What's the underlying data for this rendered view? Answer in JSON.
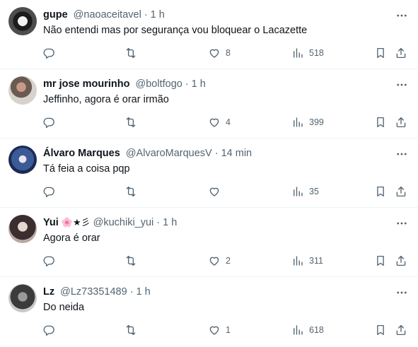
{
  "colors": {
    "text": "#0f1419",
    "secondary": "#536471",
    "divider": "#eff3f4"
  },
  "icons": {
    "reply": "reply-icon",
    "retweet": "retweet-icon",
    "like": "heart-icon",
    "views": "views-icon",
    "bookmark": "bookmark-icon",
    "share": "share-icon",
    "more": "more-icon"
  },
  "tweets": [
    {
      "name": "gupe",
      "emojis": "",
      "handle": "@naoaceitavel",
      "sep": "·",
      "time": "1 h",
      "text": "Não entendi mas por segurança vou bloquear o Lacazette",
      "likes": "8",
      "views": "518"
    },
    {
      "name": "mr jose mourinho",
      "emojis": "",
      "handle": "@boltfogo",
      "sep": "·",
      "time": "1 h",
      "text": "Jeffinho, agora é orar irmão",
      "likes": "4",
      "views": "399"
    },
    {
      "name": "Álvaro Marques",
      "emojis": "",
      "handle": "@AlvaroMarquesV",
      "sep": "·",
      "time": "14 min",
      "text": "Tá feia a coisa pqp",
      "likes": "",
      "views": "35"
    },
    {
      "name": "Yui",
      "emojis": "🌸★彡",
      "handle": "@kuchiki_yui",
      "sep": "·",
      "time": "1 h",
      "text": "Agora é orar",
      "likes": "2",
      "views": "311"
    },
    {
      "name": "Lz",
      "emojis": "",
      "handle": "@Lz73351489",
      "sep": "·",
      "time": "1 h",
      "text": "Do neida",
      "likes": "1",
      "views": "618"
    }
  ]
}
